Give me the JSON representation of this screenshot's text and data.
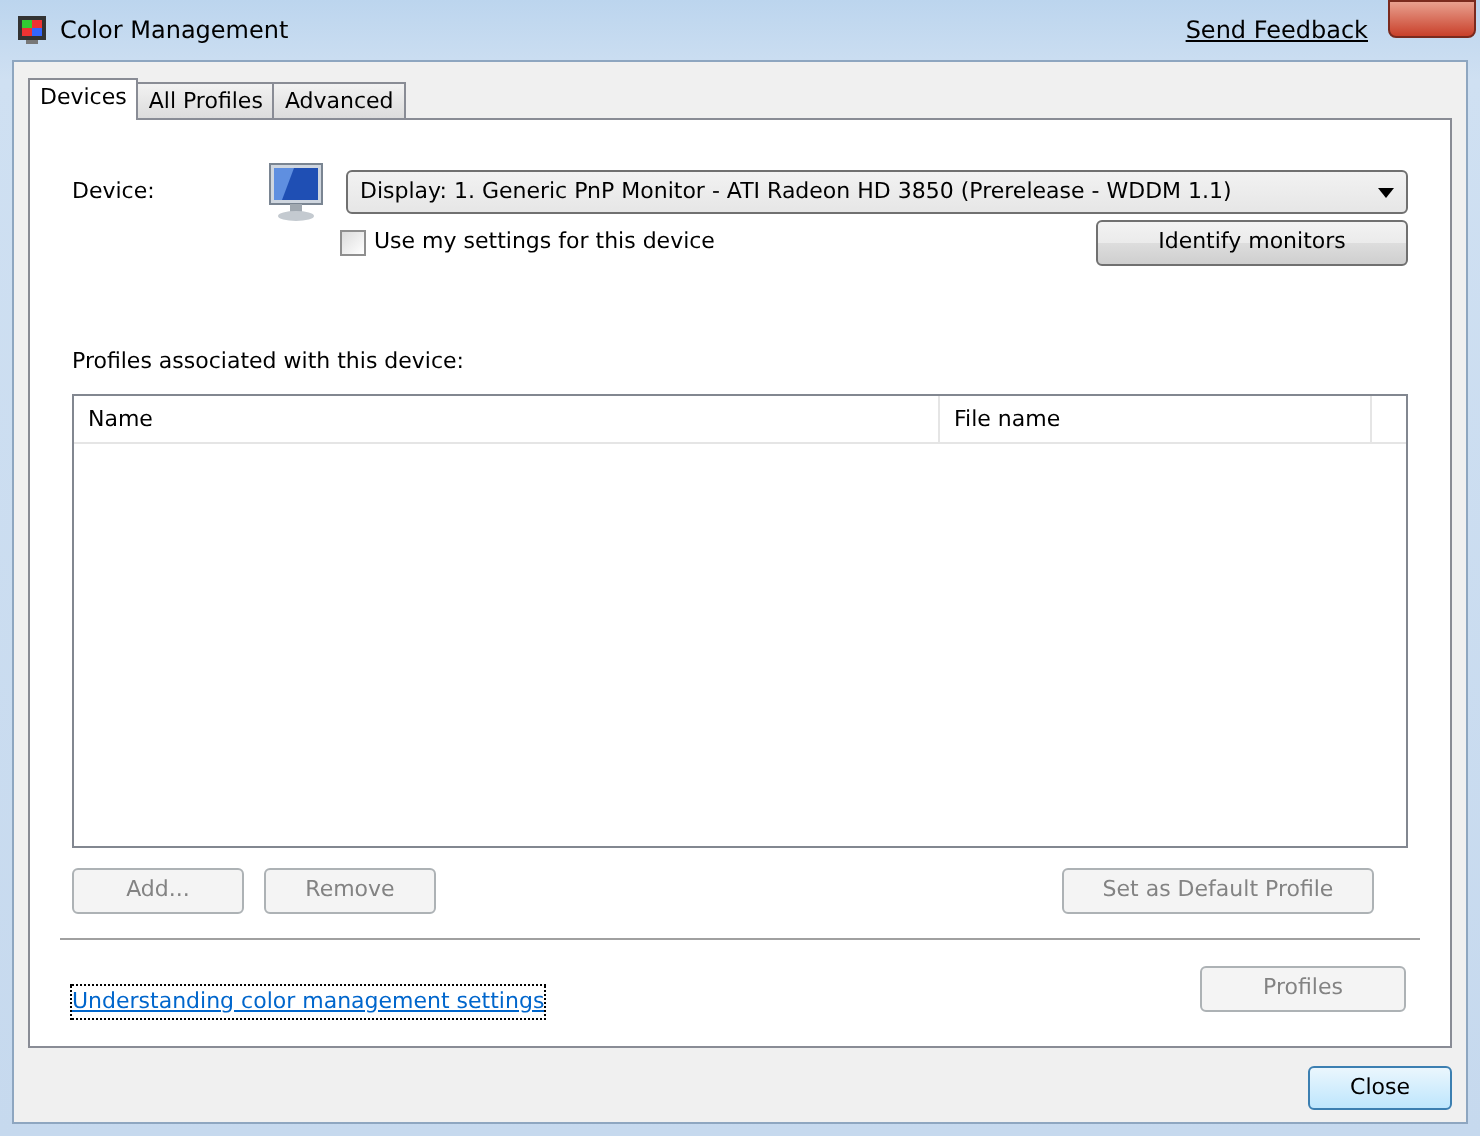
{
  "window": {
    "title": "Color Management",
    "feedback_link": "Send Feedback"
  },
  "tabs": [
    {
      "label": "Devices",
      "selected": true
    },
    {
      "label": "All Profiles",
      "selected": false
    },
    {
      "label": "Advanced",
      "selected": false
    }
  ],
  "device": {
    "label": "Device:",
    "value": "Display: 1. Generic PnP Monitor - ATI Radeon HD 3850 (Prerelease - WDDM 1.1)",
    "use_my_settings": {
      "label": "Use my settings for this device",
      "checked": false
    },
    "identify_button": {
      "label": "Identify monitors",
      "disabled": false
    }
  },
  "profiles_label": "Profiles associated with this device:",
  "table": {
    "columns": [
      "Name",
      "File name"
    ]
  },
  "profile_buttons": [
    {
      "label": "Add...",
      "disabled": true
    },
    {
      "label": "Remove",
      "disabled": true
    },
    {
      "label": "Set as Default Profile",
      "disabled": true
    }
  ],
  "help_link": "Understanding color management settings",
  "profiles_button": {
    "label": "Profiles",
    "disabled": true
  },
  "close_button": {
    "label": "Close",
    "disabled": false
  }
}
